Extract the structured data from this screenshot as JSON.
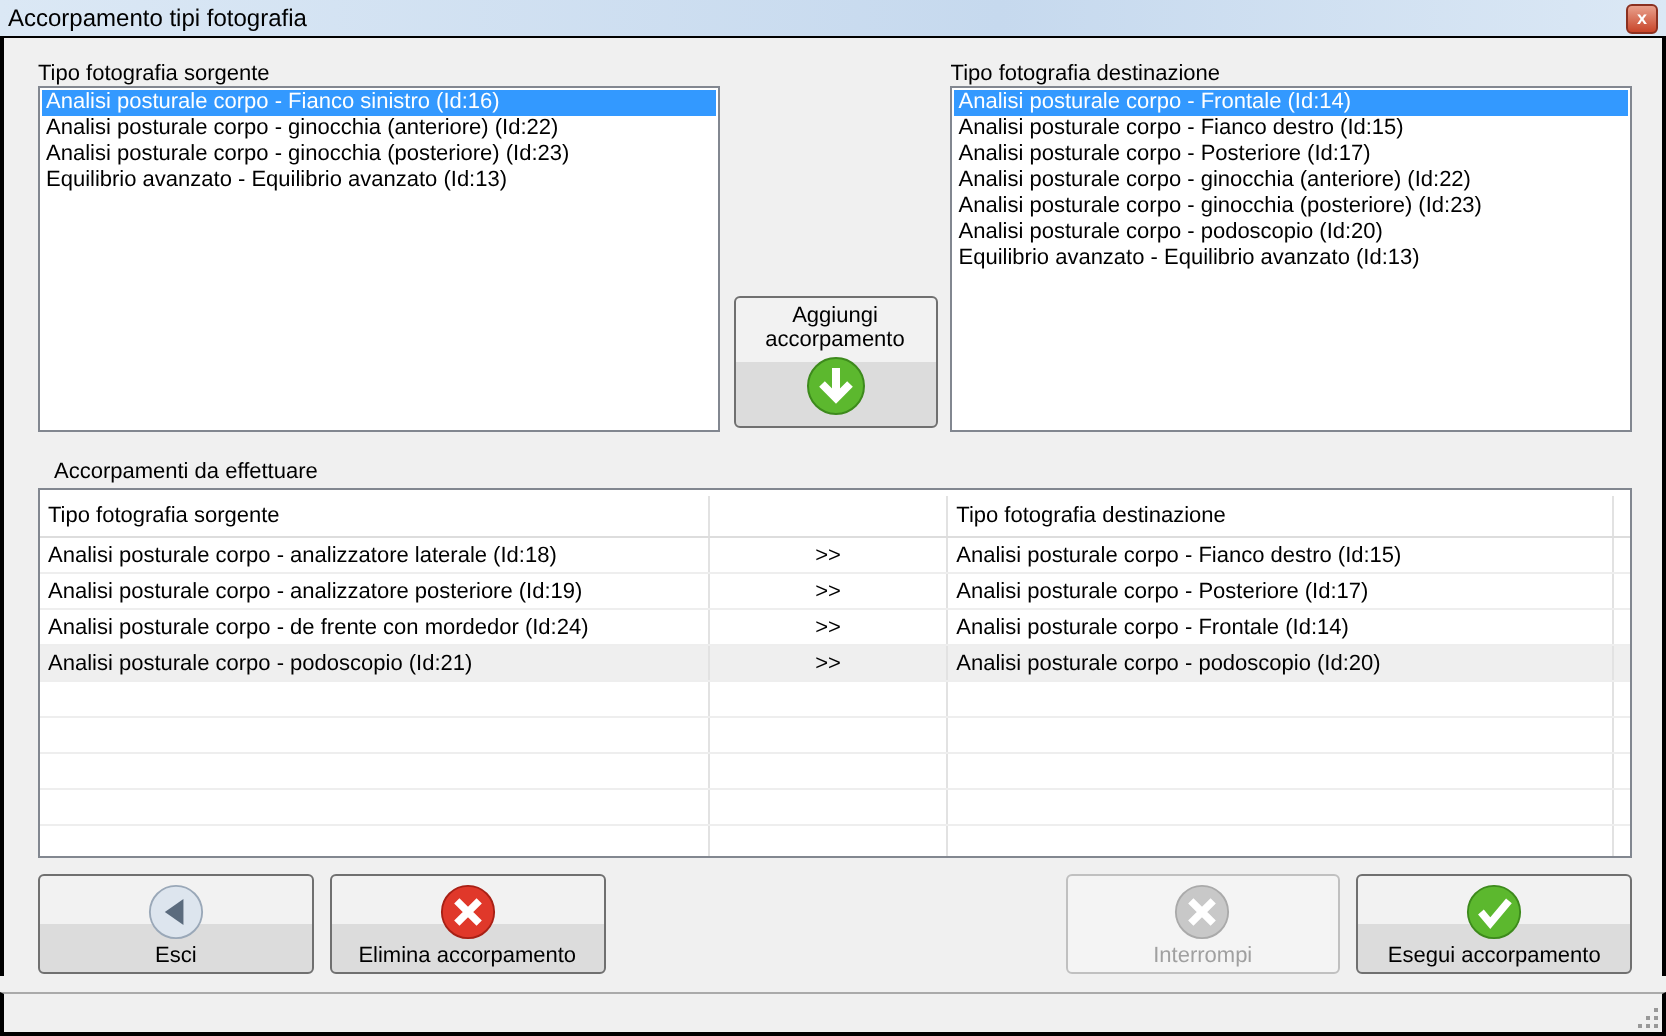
{
  "window": {
    "title": "Accorpamento tipi fotografia",
    "close": "x"
  },
  "source_list": {
    "label": "Tipo fotografia sorgente",
    "items": [
      {
        "text": "Analisi posturale corpo - Fianco sinistro (Id:16)",
        "selected": true
      },
      {
        "text": "Analisi posturale corpo - ginocchia (anteriore) (Id:22)",
        "selected": false
      },
      {
        "text": "Analisi posturale corpo - ginocchia (posteriore) (Id:23)",
        "selected": false
      },
      {
        "text": "Equilibrio avanzato - Equilibrio avanzato (Id:13)",
        "selected": false
      }
    ]
  },
  "add_button": {
    "label": "Aggiungi accorpamento",
    "kind": "down"
  },
  "destination_list": {
    "label": "Tipo fotografia destinazione",
    "items": [
      {
        "text": "Analisi posturale corpo - Frontale (Id:14)",
        "selected": true
      },
      {
        "text": "Analisi posturale corpo - Fianco destro (Id:15)",
        "selected": false
      },
      {
        "text": "Analisi posturale corpo - Posteriore (Id:17)",
        "selected": false
      },
      {
        "text": "Analisi posturale corpo - ginocchia (anteriore) (Id:22)",
        "selected": false
      },
      {
        "text": "Analisi posturale corpo - ginocchia (posteriore) (Id:23)",
        "selected": false
      },
      {
        "text": "Analisi posturale corpo - podoscopio (Id:20)",
        "selected": false
      },
      {
        "text": "Equilibrio avanzato - Equilibrio avanzato (Id:13)",
        "selected": false
      }
    ]
  },
  "mappings": {
    "label": "Accorpamenti da effettuare",
    "columns": [
      "Tipo fotografia sorgente",
      "Tipo fotografia destinazione"
    ],
    "rows": [
      {
        "source": "Analisi posturale corpo - analizzatore laterale (Id:18)",
        "arrow": ">>",
        "destination": "Analisi posturale corpo - Fianco destro (Id:15)",
        "selected": false
      },
      {
        "source": "Analisi posturale corpo - analizzatore posteriore (Id:19)",
        "arrow": ">>",
        "destination": "Analisi posturale corpo - Posteriore (Id:17)",
        "selected": false
      },
      {
        "source": "Analisi posturale corpo - de frente con mordedor (Id:24)",
        "arrow": ">>",
        "destination": "Analisi posturale corpo - Frontale (Id:14)",
        "selected": false
      },
      {
        "source": "Analisi posturale corpo - podoscopio (Id:21)",
        "arrow": ">>",
        "destination": "Analisi posturale corpo - podoscopio (Id:20)",
        "selected": true
      }
    ]
  },
  "buttons": [
    {
      "label": "Esci",
      "kind": "back",
      "disabled": false
    },
    {
      "label": "Elimina accorpamento",
      "kind": "cancel",
      "disabled": false
    },
    {
      "label": "Interrompi",
      "kind": "cancel",
      "disabled": true
    },
    {
      "label": "Esegui accorpamento",
      "kind": "ok",
      "disabled": false
    }
  ]
}
